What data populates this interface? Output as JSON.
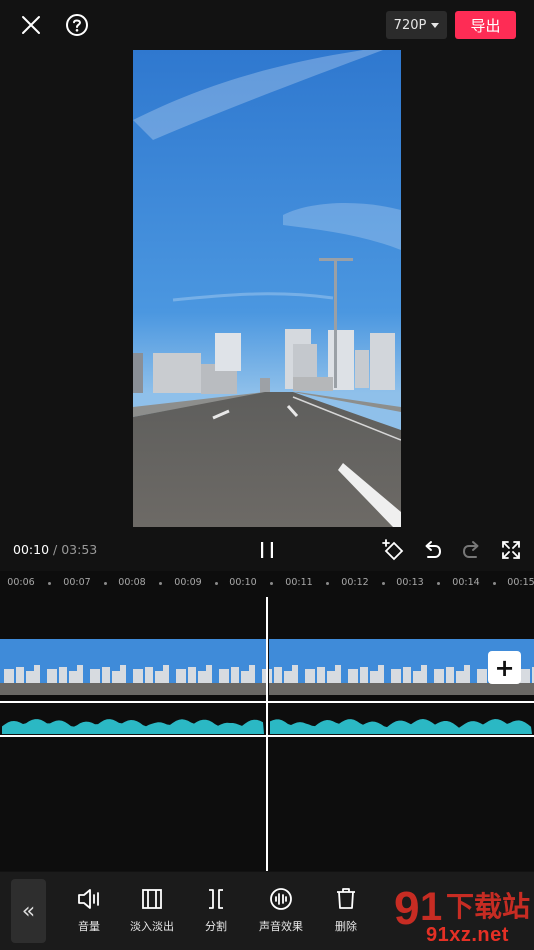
{
  "top": {
    "resolution": "720P",
    "export_label": "导出"
  },
  "playback": {
    "current_time": "00:10",
    "separator": " / ",
    "total_time": "03:53"
  },
  "ruler": {
    "ticks": [
      "00:06",
      "00:07",
      "00:08",
      "00:09",
      "00:10",
      "00:11",
      "00:12",
      "00:13",
      "00:14",
      "00:15"
    ]
  },
  "timeline": {
    "add_clip_symbol": "+"
  },
  "toolbar": {
    "back_symbol": "«",
    "tools": [
      {
        "label": "音量",
        "icon": "volume-icon"
      },
      {
        "label": "淡入淡出",
        "icon": "fade-icon"
      },
      {
        "label": "分割",
        "icon": "split-icon"
      },
      {
        "label": "声音效果",
        "icon": "voice-effect-icon"
      },
      {
        "label": "删除",
        "icon": "delete-icon"
      }
    ]
  },
  "watermark": {
    "text": "91xz.net",
    "logo_text": "下载站"
  },
  "colors": {
    "accent": "#fe2c55",
    "waveform": "#2bb8c4",
    "sky": "#3d86d6"
  }
}
